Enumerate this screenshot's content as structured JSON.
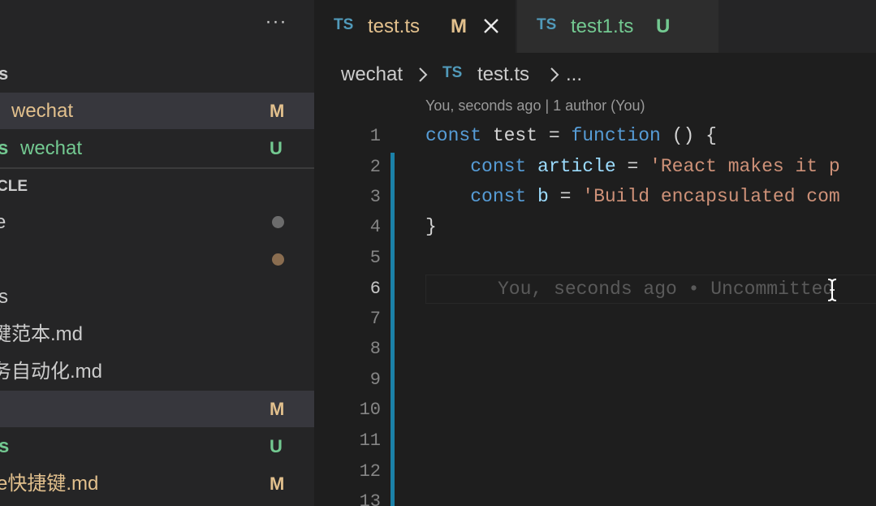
{
  "sidebar": {
    "more_label": "···",
    "rows": [
      {
        "label": "s",
        "badge": ""
      },
      {
        "label": "wechat",
        "badge": "M"
      },
      {
        "prefix": "s",
        "label": "wechat",
        "badge": "U"
      },
      {
        "label": "CLE"
      },
      {
        "label": "e",
        "dot_color": "#6c6c6c"
      },
      {
        "dot_color": "#8a6d50"
      },
      {
        "label": "s"
      },
      {
        "label": "键范本.md"
      },
      {
        "label": "务自动化.md"
      },
      {
        "badge": "M"
      },
      {
        "label": "s",
        "badge": "U"
      },
      {
        "label": "e快捷键.md",
        "badge": "M"
      }
    ]
  },
  "tabs": [
    {
      "icon": "TS",
      "name": "test.ts",
      "status": "M",
      "close": "close-icon"
    },
    {
      "icon": "TS",
      "name": "test1.ts",
      "status": "U"
    }
  ],
  "breadcrumb": {
    "folder": "wechat",
    "icon": "TS",
    "file": "test.ts",
    "more": "..."
  },
  "editor": {
    "blame": "You, seconds ago | 1 author (You)",
    "line_numbers": [
      "1",
      "2",
      "3",
      "4",
      "5",
      "6",
      "7",
      "8",
      "9",
      "10",
      "11",
      "12",
      "13"
    ],
    "current_line": "6",
    "code": {
      "l1_kw": "const",
      "l1_name": " test = ",
      "l1_fn": "function",
      "l1_rest": " () {",
      "l2_indent": "    ",
      "l2_kw": "const",
      "l2_var": " article",
      "l2_eq": " = ",
      "l2_str": "'React makes it p",
      "l3_indent": "    ",
      "l3_kw": "const",
      "l3_var": " b",
      "l3_eq": " = ",
      "l3_str": "'Build encapsulated com",
      "l4": "}"
    },
    "ghost_blame": "You, seconds ago • Uncommitted"
  },
  "colors": {
    "modified": "#e2c08d",
    "untracked": "#73c991",
    "keyword": "#569cd6",
    "variable": "#9cdcfe",
    "string": "#ce9178",
    "ts_icon": "#519aba"
  }
}
